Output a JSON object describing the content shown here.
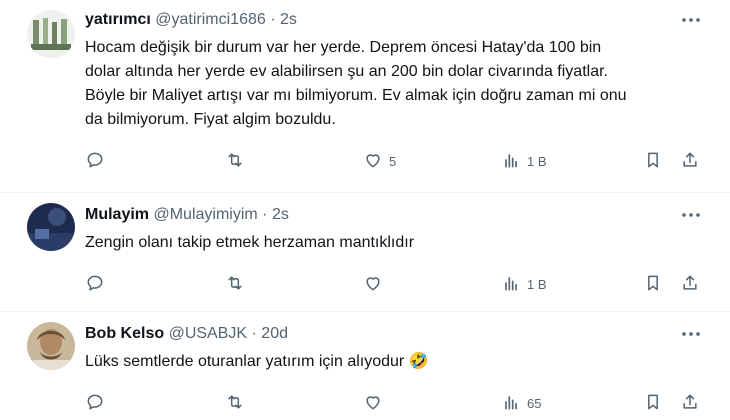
{
  "tweets": [
    {
      "name": "yatırımcı",
      "handle": "@yatirimci1686",
      "dot": "·",
      "time": "2s",
      "lines": [
        "Hocam değişik bir durum var her yerde. Deprem öncesi Hatay'da 100 bin",
        "dolar altında her yerde ev alabilirsen şu an 200 bin dolar civarında fiyatlar.",
        "Böyle bir Maliyet artışı var mı bilmiyorum. Ev almak için doğru zaman mi onu",
        "da bilmiyorum. Fiyat algim bozuldu."
      ],
      "emoji": "",
      "reply_count": "",
      "retweet_count": "",
      "like_count": "5",
      "views": "1 B"
    },
    {
      "name": "Mulayim",
      "handle": "@Mulayimiyim",
      "dot": "·",
      "time": "2s",
      "lines": [
        "Zengin olanı takip etmek herzaman mantıklıdır"
      ],
      "emoji": "",
      "reply_count": "",
      "retweet_count": "",
      "like_count": "",
      "views": "1 B"
    },
    {
      "name": "Bob Kelso",
      "handle": "@USABJK",
      "dot": "·",
      "time": "20d",
      "lines": [
        "Lüks semtlerde oturanlar yatırım için alıyodur"
      ],
      "emoji": "🤣",
      "reply_count": "",
      "retweet_count": "",
      "like_count": "",
      "views": "65"
    }
  ],
  "icons": {
    "reply": "reply-icon",
    "retweet": "retweet-icon",
    "like": "like-icon",
    "views": "views-icon",
    "bookmark": "bookmark-icon",
    "share": "share-icon",
    "more": "more-icon"
  },
  "colors": {
    "text": "#0f1419",
    "muted": "#536471",
    "divider": "#eff3f4"
  }
}
